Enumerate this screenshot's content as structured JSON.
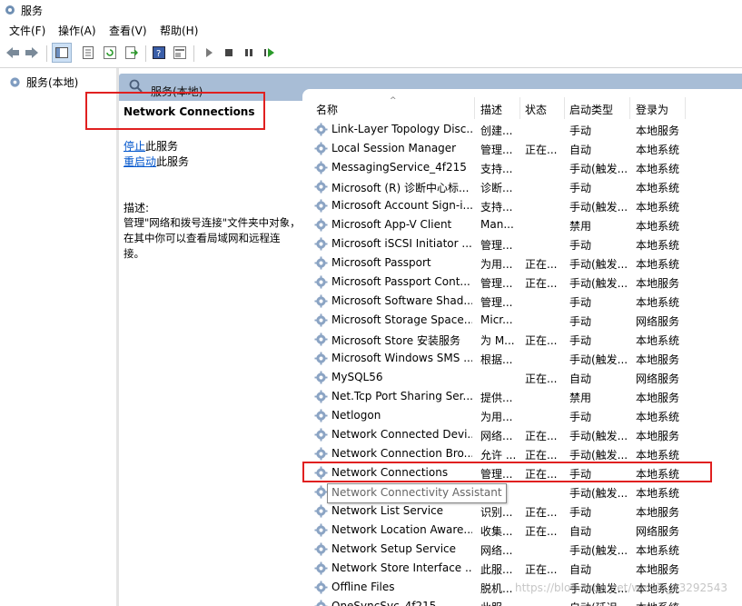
{
  "window": {
    "title": "服务"
  },
  "menu": [
    "文件(F)",
    "操作(A)",
    "查看(V)",
    "帮助(H)"
  ],
  "tree": {
    "root_label": "服务(本地)"
  },
  "panel": {
    "header_title": "服务(本地)"
  },
  "detail": {
    "service_name": "Network Connections",
    "stop_link": "停止",
    "stop_suffix": "此服务",
    "restart_link": "重启动",
    "restart_suffix": "此服务",
    "desc_label": "描述:",
    "desc_text": "管理\"网络和拨号连接\"文件夹中对象，在其中你可以查看局域网和远程连接。"
  },
  "columns": {
    "name": "名称",
    "desc": "描述",
    "state": "状态",
    "start": "启动类型",
    "logon": "登录为"
  },
  "services": [
    {
      "name": "Link-Layer Topology Disc...",
      "desc": "创建...",
      "state": "",
      "start": "手动",
      "logon": "本地服务"
    },
    {
      "name": "Local Session Manager",
      "desc": "管理...",
      "state": "正在...",
      "start": "自动",
      "logon": "本地系统"
    },
    {
      "name": "MessagingService_4f215",
      "desc": "支持...",
      "state": "",
      "start": "手动(触发...",
      "logon": "本地系统"
    },
    {
      "name": "Microsoft (R) 诊断中心标...",
      "desc": "诊断...",
      "state": "",
      "start": "手动",
      "logon": "本地系统"
    },
    {
      "name": "Microsoft Account Sign-i...",
      "desc": "支持...",
      "state": "",
      "start": "手动(触发...",
      "logon": "本地系统"
    },
    {
      "name": "Microsoft App-V Client",
      "desc": "Man...",
      "state": "",
      "start": "禁用",
      "logon": "本地系统"
    },
    {
      "name": "Microsoft iSCSI Initiator ...",
      "desc": "管理...",
      "state": "",
      "start": "手动",
      "logon": "本地系统"
    },
    {
      "name": "Microsoft Passport",
      "desc": "为用...",
      "state": "正在...",
      "start": "手动(触发...",
      "logon": "本地系统"
    },
    {
      "name": "Microsoft Passport Cont...",
      "desc": "管理...",
      "state": "正在...",
      "start": "手动(触发...",
      "logon": "本地服务"
    },
    {
      "name": "Microsoft Software Shad...",
      "desc": "管理...",
      "state": "",
      "start": "手动",
      "logon": "本地系统"
    },
    {
      "name": "Microsoft Storage Space...",
      "desc": "Micr...",
      "state": "",
      "start": "手动",
      "logon": "网络服务"
    },
    {
      "name": "Microsoft Store 安装服务",
      "desc": "为 M...",
      "state": "正在...",
      "start": "手动",
      "logon": "本地系统"
    },
    {
      "name": "Microsoft Windows SMS ...",
      "desc": "根据...",
      "state": "",
      "start": "手动(触发...",
      "logon": "本地服务"
    },
    {
      "name": "MySQL56",
      "desc": "",
      "state": "正在...",
      "start": "自动",
      "logon": "网络服务"
    },
    {
      "name": "Net.Tcp Port Sharing Ser...",
      "desc": "提供...",
      "state": "",
      "start": "禁用",
      "logon": "本地服务"
    },
    {
      "name": "Netlogon",
      "desc": "为用...",
      "state": "",
      "start": "手动",
      "logon": "本地系统"
    },
    {
      "name": "Network Connected Devi...",
      "desc": "网络...",
      "state": "正在...",
      "start": "手动(触发...",
      "logon": "本地服务"
    },
    {
      "name": "Network Connection Bro...",
      "desc": "允许 ...",
      "state": "正在...",
      "start": "手动(触发...",
      "logon": "本地系统"
    },
    {
      "name": "Network Connections",
      "desc": "管理...",
      "state": "正在...",
      "start": "手动",
      "logon": "本地系统"
    },
    {
      "name": "",
      "desc": "",
      "state": "",
      "start": "手动(触发...",
      "logon": "本地系统"
    },
    {
      "name": "Network List Service",
      "desc": "识别...",
      "state": "正在...",
      "start": "手动",
      "logon": "本地服务"
    },
    {
      "name": "Network Location Aware...",
      "desc": "收集...",
      "state": "正在...",
      "start": "自动",
      "logon": "网络服务"
    },
    {
      "name": "Network Setup Service",
      "desc": "网络...",
      "state": "",
      "start": "手动(触发...",
      "logon": "本地系统"
    },
    {
      "name": "Network Store Interface ...",
      "desc": "此服...",
      "state": "正在...",
      "start": "自动",
      "logon": "本地服务"
    },
    {
      "name": "Offline Files",
      "desc": "脱机...",
      "state": "",
      "start": "手动(触发...",
      "logon": "本地系统"
    },
    {
      "name": "OneSyncSvc_4f215",
      "desc": "此服...",
      "state": "",
      "start": "自动(延迟...",
      "logon": "本地系统"
    }
  ],
  "tooltip": "Network Connectivity Assistant",
  "watermark": "https://blog.csdn.net/weixin_43292543",
  "colors": {
    "header_bg": "#a8bdd6",
    "highlight": "#e02020",
    "link": "#0055cc"
  }
}
